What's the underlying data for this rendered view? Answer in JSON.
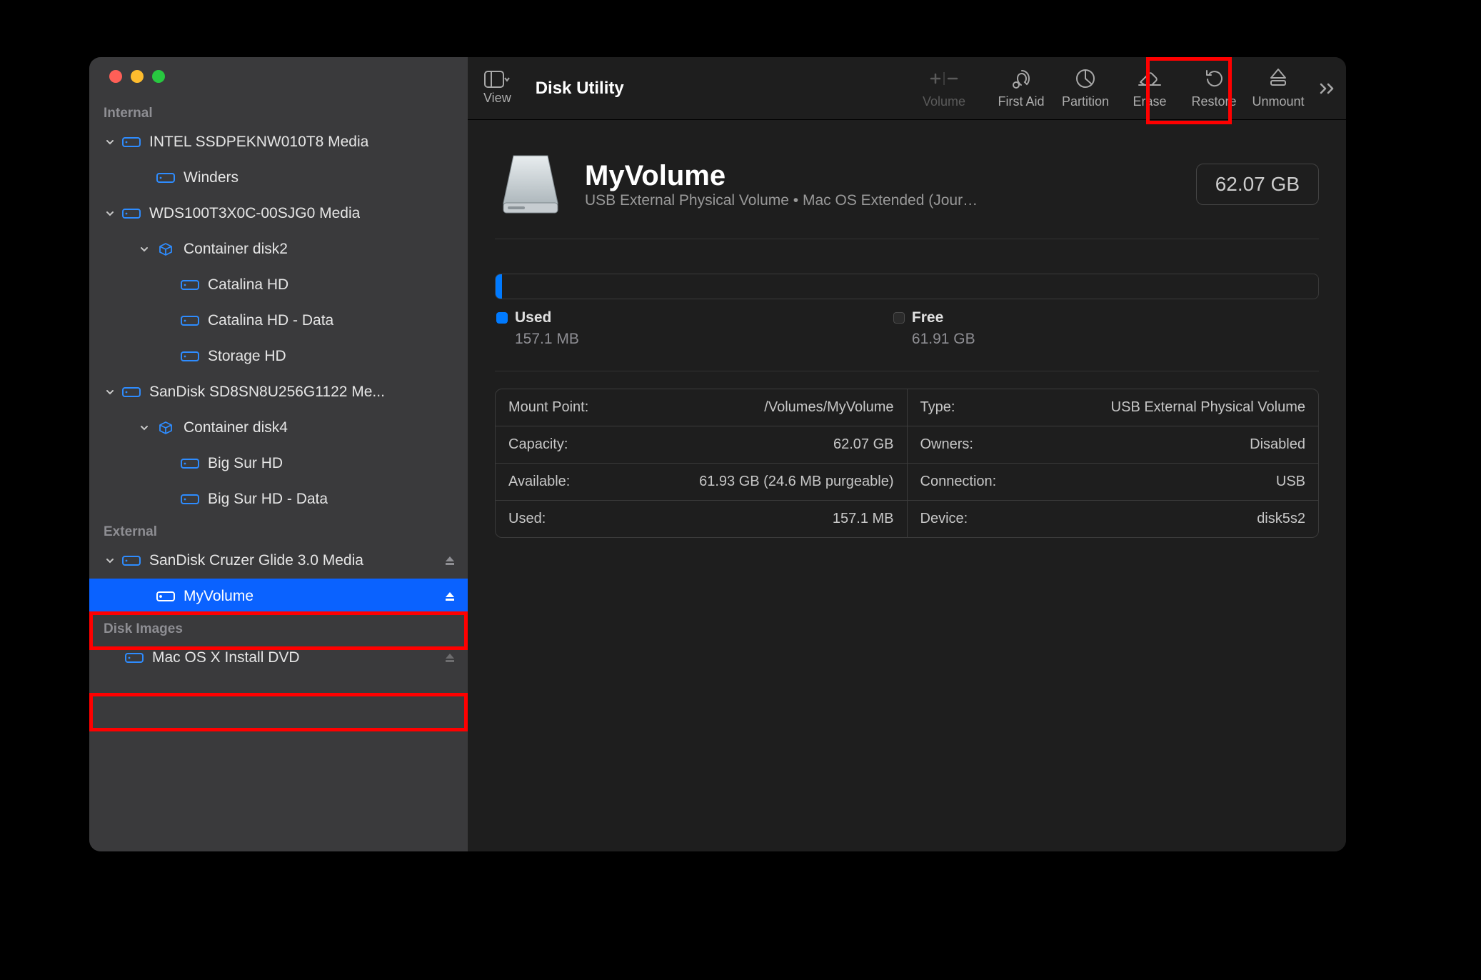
{
  "window": {
    "title": "Disk Utility"
  },
  "toolbar": {
    "view": "View",
    "volume": "Volume",
    "first_aid": "First Aid",
    "partition": "Partition",
    "erase": "Erase",
    "restore": "Restore",
    "unmount": "Unmount"
  },
  "sidebar": {
    "internal_heading": "Internal",
    "external_heading": "External",
    "disk_images_heading": "Disk Images",
    "internal": [
      {
        "label": "INTEL SSDPEKNW010T8 Media",
        "children": [
          {
            "label": "Winders"
          }
        ]
      },
      {
        "label": "WDS100T3X0C-00SJG0 Media",
        "children": [
          {
            "label": "Container disk2",
            "children": [
              {
                "label": "Catalina HD"
              },
              {
                "label": "Catalina HD - Data"
              },
              {
                "label": "Storage HD"
              }
            ]
          }
        ]
      },
      {
        "label": "SanDisk SD8SN8U256G1122 Me...",
        "children": [
          {
            "label": "Container disk4",
            "children": [
              {
                "label": "Big Sur HD"
              },
              {
                "label": "Big Sur HD - Data"
              }
            ]
          }
        ]
      }
    ],
    "external": [
      {
        "label": "SanDisk Cruzer Glide 3.0 Media",
        "children": [
          {
            "label": "MyVolume",
            "selected": true,
            "ejectable": true
          }
        ]
      }
    ],
    "disk_images": [
      {
        "label": "Mac OS X Install DVD"
      }
    ]
  },
  "volume": {
    "name": "MyVolume",
    "subtitle": "USB External Physical Volume • Mac OS Extended (Jour…",
    "size": "62.07 GB",
    "usage_pct": 0.8
  },
  "legend": {
    "used_label": "Used",
    "used_value": "157.1 MB",
    "free_label": "Free",
    "free_value": "61.91 GB"
  },
  "info_left": [
    {
      "k": "Mount Point:",
      "v": "/Volumes/MyVolume"
    },
    {
      "k": "Capacity:",
      "v": "62.07 GB"
    },
    {
      "k": "Available:",
      "v": "61.93 GB (24.6 MB purgeable)"
    },
    {
      "k": "Used:",
      "v": "157.1 MB"
    }
  ],
  "info_right": [
    {
      "k": "Type:",
      "v": "USB External Physical Volume"
    },
    {
      "k": "Owners:",
      "v": "Disabled"
    },
    {
      "k": "Connection:",
      "v": "USB"
    },
    {
      "k": "Device:",
      "v": "disk5s2"
    }
  ]
}
